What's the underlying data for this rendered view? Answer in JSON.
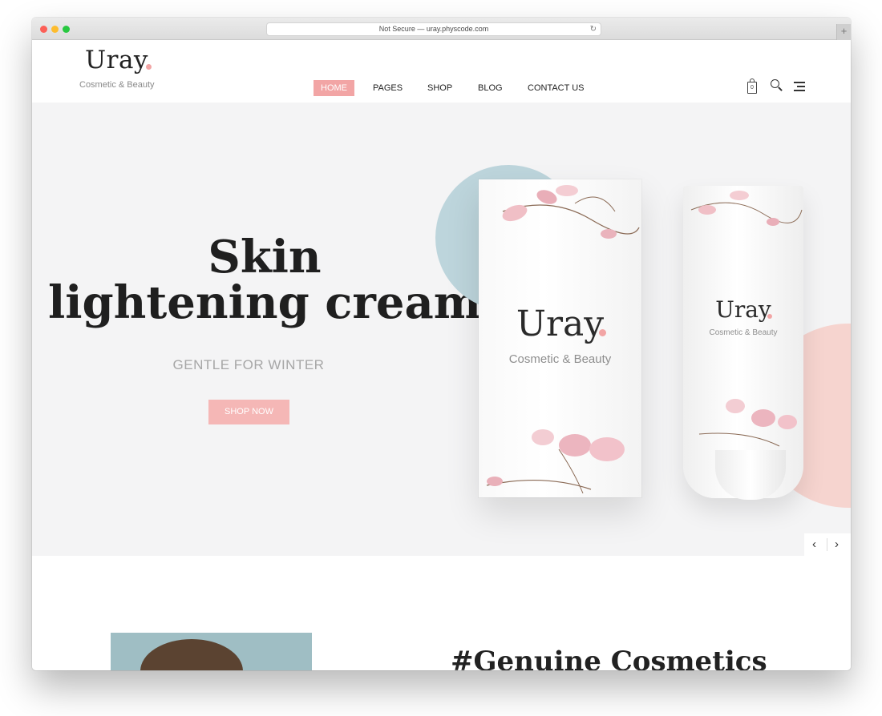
{
  "browser": {
    "url": "Not Secure — uray.physcode.com"
  },
  "header": {
    "logo": "Uray",
    "tagline": "Cosmetic & Beauty",
    "nav": [
      "HOME",
      "PAGES",
      "SHOP",
      "BLOG",
      "CONTACT US"
    ],
    "active_nav": "HOME",
    "cart_count": "0",
    "icons": [
      "bag-icon",
      "search-icon",
      "menu-icon"
    ]
  },
  "hero": {
    "title_line1": "Skin",
    "title_line2": "lightening cream",
    "subtitle": "GENTLE FOR WINTER",
    "cta": "SHOP NOW",
    "box_brand": "Uray",
    "box_tagline": "Cosmetic & Beauty",
    "tube_brand": "Uray",
    "tube_tagline": "Cosmetic & Beauty"
  },
  "section": {
    "heading": "#Genuine Cosmetics"
  },
  "colors": {
    "accent": "#f2a5a5",
    "hero_bg": "#f4f4f5",
    "blue_circle": "#bdd5dc",
    "pink_circle": "#f6d4cf"
  }
}
